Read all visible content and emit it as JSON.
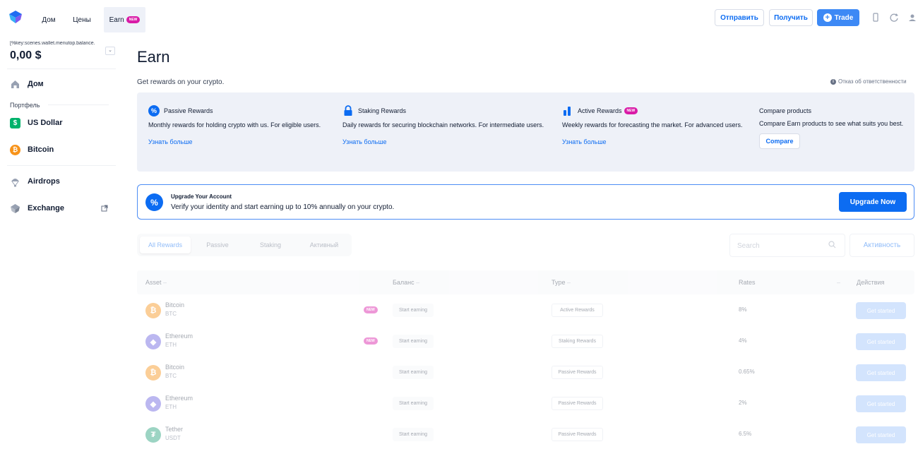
{
  "topbar": {
    "nav": [
      {
        "label": "Дом"
      },
      {
        "label": "Цены"
      },
      {
        "label": "Earn",
        "badge": "NEW"
      }
    ],
    "send_label": "Отправить",
    "receive_label": "Получить",
    "trade_label": "Trade",
    "trade_icon": "+"
  },
  "sidebar": {
    "balance_label": "[%key:scenes.wallet.menutop.balance.",
    "balance_value": "0,00 $",
    "portfolio_label": "Портфель",
    "items": [
      {
        "label": "Дом",
        "icon": "home-icon"
      },
      {
        "label": "US Dollar",
        "icon": "usd-coin-icon"
      },
      {
        "label": "Bitcoin",
        "icon": "bitcoin-coin-icon"
      },
      {
        "label": "Airdrops",
        "icon": "parachute-icon"
      },
      {
        "label": "Exchange",
        "icon": "exchange-logo-icon"
      }
    ]
  },
  "main": {
    "title": "Earn",
    "subtitle": "Get rewards on your crypto.",
    "disclaimer": "Отказ об ответственности",
    "products": [
      {
        "title": "Passive Rewards",
        "desc": "Monthly rewards for holding crypto with us. For eligible users.",
        "link": "Узнать больше"
      },
      {
        "title": "Staking Rewards",
        "desc": "Daily rewards for securing blockchain networks. For intermediate users.",
        "link": "Узнать больше"
      },
      {
        "title": "Active Rewards",
        "badge": "NEW",
        "desc": "Weekly rewards for forecasting the market. For advanced users.",
        "link": "Узнать больше"
      },
      {
        "title": "Compare products",
        "desc": "Compare Earn products to see what suits you best.",
        "button": "Compare"
      }
    ],
    "upgrade": {
      "title": "Upgrade Your Account",
      "text": "Verify your identity and start earning up to 10% annually on your crypto.",
      "button": "Upgrade Now",
      "icon": "%"
    },
    "tabs": [
      "All Rewards",
      "Passive",
      "Staking",
      "Активный"
    ],
    "search_placeholder": "Search",
    "activity_label": "Активность",
    "table": {
      "headers": [
        "Asset",
        "Баланс",
        "Type",
        "Rates",
        "Действия"
      ],
      "rows": [
        {
          "name": "Bitcoin",
          "symbol": "BTC",
          "new": "NEW",
          "balance": "Start earning",
          "type": "Active Rewards",
          "rate": "8%",
          "action": "Get started",
          "coin_glyph": "₿"
        },
        {
          "name": "Ethereum",
          "symbol": "ETH",
          "new": "NEW",
          "balance": "Start earning",
          "type": "Staking Rewards",
          "rate": "4%",
          "action": "Get started",
          "coin_glyph": "◆"
        },
        {
          "name": "Bitcoin",
          "symbol": "BTC",
          "balance": "Start earning",
          "type": "Passive Rewards",
          "rate": "0.65%",
          "action": "Get started",
          "coin_glyph": "₿"
        },
        {
          "name": "Ethereum",
          "symbol": "ETH",
          "balance": "Start earning",
          "type": "Passive Rewards",
          "rate": "2%",
          "action": "Get started",
          "coin_glyph": "◆"
        },
        {
          "name": "Tether",
          "symbol": "USDT",
          "balance": "Start earning",
          "type": "Passive Rewards",
          "rate": "6.5%",
          "action": "Get started",
          "coin_glyph": "₮"
        }
      ]
    }
  },
  "colors": {
    "accent": "#0c6cf2",
    "badge": "#d91ba7",
    "bitcoin": "#f7931a",
    "ethereum": "#6b61e0",
    "tether": "#26a17b",
    "usd": "#00b26b",
    "panel": "#eef1f8"
  }
}
